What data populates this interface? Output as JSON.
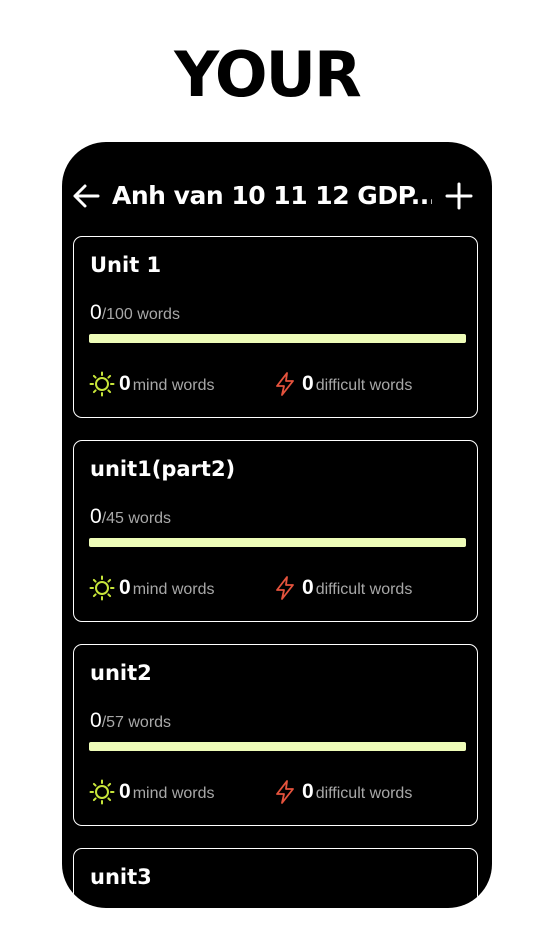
{
  "promo": {
    "title": "YOUR"
  },
  "header": {
    "title": "Anh van 10 11 12 GDP..."
  },
  "colors": {
    "progress": "#eefcb8",
    "sun": "#c8e63a",
    "bolt": "#e5533d"
  },
  "icons": {
    "back": "arrow-left-icon",
    "add": "plus-icon",
    "mind": "sun-icon",
    "difficult": "lightning-icon"
  },
  "units": [
    {
      "name": "Unit 1",
      "learned": "0",
      "total": "/100 words",
      "progress": 0,
      "mind_count": "0",
      "mind_label": "mind words",
      "difficult_count": "0",
      "difficult_label": "difficult words"
    },
    {
      "name": "unit1(part2)",
      "learned": "0",
      "total": "/45 words",
      "progress": 0,
      "mind_count": "0",
      "mind_label": "mind words",
      "difficult_count": "0",
      "difficult_label": "difficult words"
    },
    {
      "name": "unit2",
      "learned": "0",
      "total": "/57 words",
      "progress": 0,
      "mind_count": "0",
      "mind_label": "mind words",
      "difficult_count": "0",
      "difficult_label": "difficult words"
    },
    {
      "name": "unit3"
    }
  ]
}
